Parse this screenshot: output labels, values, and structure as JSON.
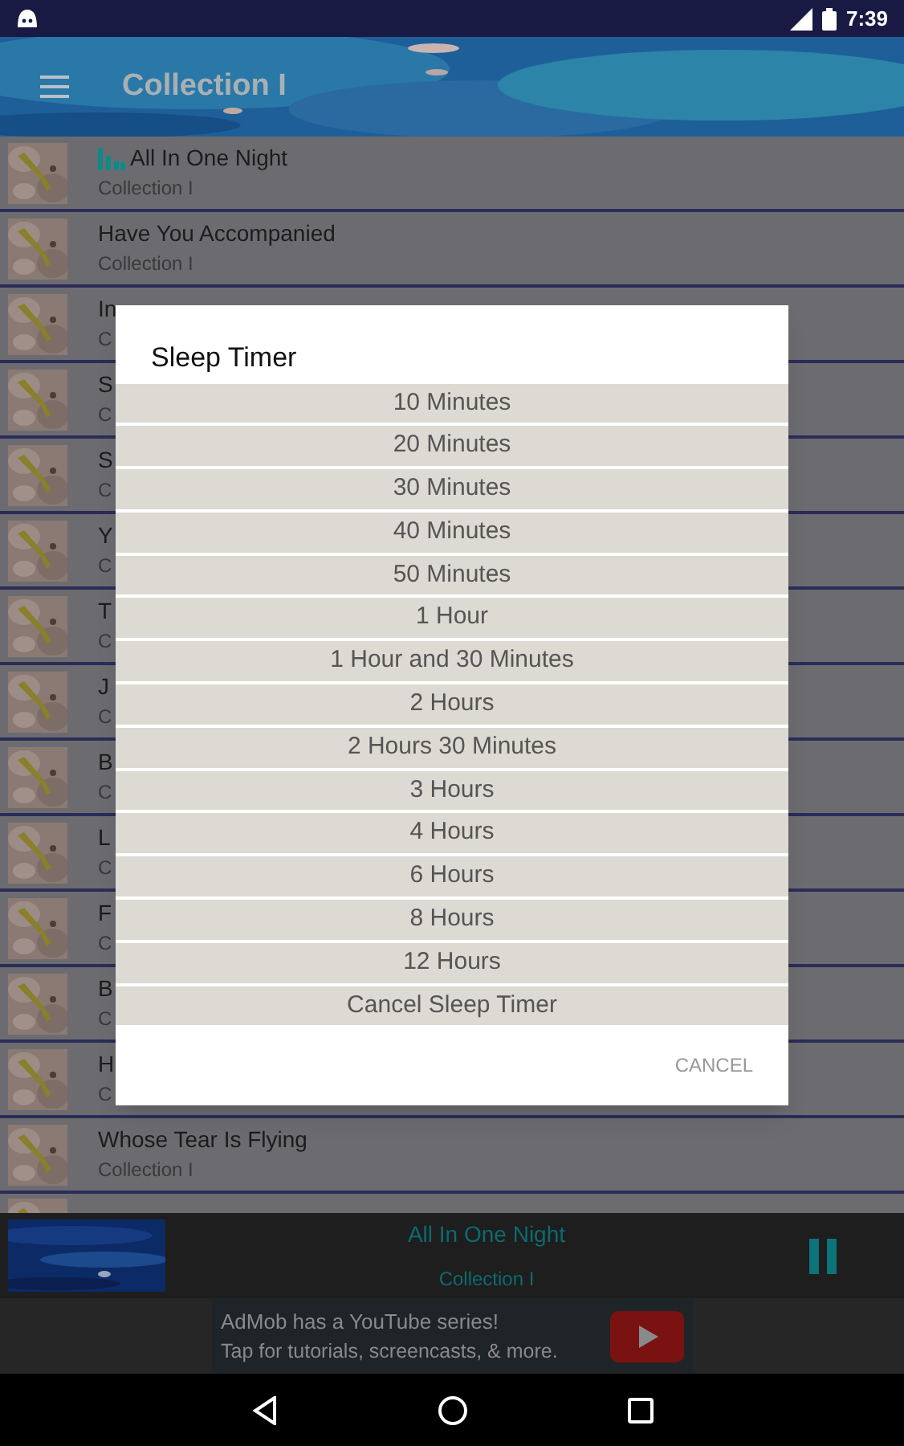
{
  "status_bar": {
    "time": "7:39"
  },
  "toolbar": {
    "title": "Collection I"
  },
  "songs": [
    {
      "title": "All In One Night",
      "subtitle": "Collection I",
      "playing": true
    },
    {
      "title": "Have You Accompanied",
      "subtitle": "Collection I",
      "playing": false
    },
    {
      "title": "In",
      "subtitle": "C",
      "playing": false
    },
    {
      "title": "S",
      "subtitle": "C",
      "playing": false
    },
    {
      "title": "S",
      "subtitle": "C",
      "playing": false
    },
    {
      "title": "Y",
      "subtitle": "C",
      "playing": false
    },
    {
      "title": "T",
      "subtitle": "C",
      "playing": false
    },
    {
      "title": "J",
      "subtitle": "C",
      "playing": false
    },
    {
      "title": "B",
      "subtitle": "C",
      "playing": false
    },
    {
      "title": "L",
      "subtitle": "C",
      "playing": false
    },
    {
      "title": "F",
      "subtitle": "C",
      "playing": false
    },
    {
      "title": "B",
      "subtitle": "C",
      "playing": false
    },
    {
      "title": "H",
      "subtitle": "C",
      "playing": false
    },
    {
      "title": "Whose Tear Is Flying",
      "subtitle": "Collection I",
      "playing": false
    }
  ],
  "dialog": {
    "title": "Sleep Timer",
    "options": [
      "10 Minutes",
      "20 Minutes",
      "30 Minutes",
      "40 Minutes",
      "50 Minutes",
      "1 Hour",
      "1 Hour and 30 Minutes",
      "2 Hours",
      "2 Hours 30 Minutes",
      "3 Hours",
      "4 Hours",
      "6 Hours",
      "8 Hours",
      "12 Hours",
      "Cancel Sleep Timer"
    ],
    "cancel": "CANCEL"
  },
  "player": {
    "title": "All In One Night",
    "subtitle": "Collection I",
    "playing": true
  },
  "ad": {
    "line_1": "AdMob has a YouTube series!",
    "line_2": "Tap for tutorials, screencasts, & more."
  }
}
